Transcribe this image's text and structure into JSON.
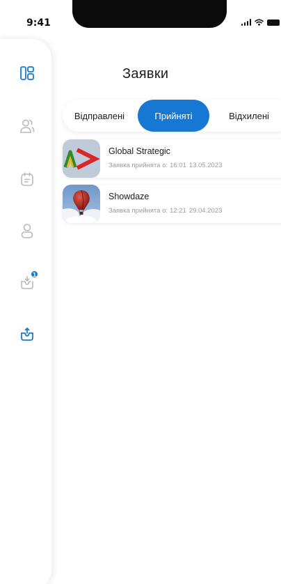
{
  "status_bar": {
    "time": "9:41"
  },
  "page": {
    "title": "Заявки"
  },
  "tabs": [
    {
      "label": "Відправлені",
      "active": false
    },
    {
      "label": "Прийняті",
      "active": true
    },
    {
      "label": "Відхилені",
      "active": false
    }
  ],
  "sidebar": {
    "items": [
      {
        "icon": "dashboard-icon",
        "active": true
      },
      {
        "icon": "users-icon",
        "active": false
      },
      {
        "icon": "calendar-icon",
        "active": false
      },
      {
        "icon": "profile-icon",
        "active": false
      },
      {
        "icon": "inbox-icon",
        "active": false,
        "badge": "1"
      },
      {
        "icon": "outbox-icon",
        "active": true
      }
    ]
  },
  "requests": [
    {
      "name": "Global Strategic",
      "status_prefix": "Заявка прийнята о:",
      "time": "16:01",
      "date": "13.05.2023",
      "thumb": "global-strategic-logo"
    },
    {
      "name": "Showdaze",
      "status_prefix": "Заявка прийнята о:",
      "time": "12:21",
      "date": "29.04.2023",
      "thumb": "hot-air-balloon-photo"
    }
  ],
  "colors": {
    "accent": "#1778d4",
    "muted_icon": "#b9b9b9",
    "subtext": "#9a9a9a"
  }
}
